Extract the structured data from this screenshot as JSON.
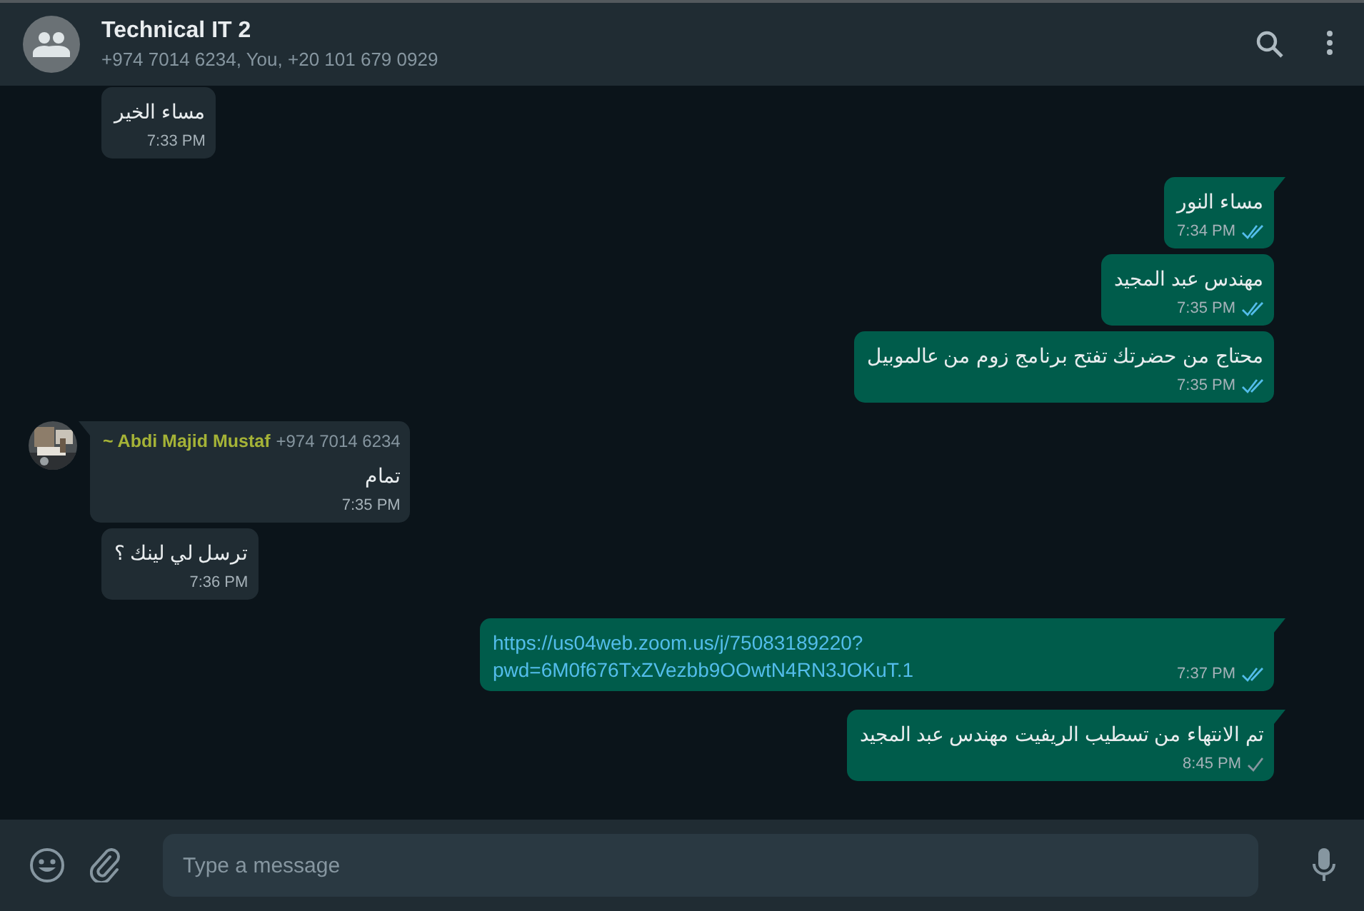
{
  "header": {
    "title": "Technical IT 2",
    "subtitle": "+974 7014 6234, You, +20 101 679 0929"
  },
  "messages": [
    {
      "kind": "incoming",
      "text": "مساء الخير",
      "time": "7:33 PM",
      "tail": false
    },
    {
      "kind": "outgoing",
      "text": "مساء النور",
      "time": "7:34 PM",
      "tail": true,
      "delivered": true,
      "read": true
    },
    {
      "kind": "outgoing",
      "text": "مهندس عبد المجيد",
      "time": "7:35 PM",
      "tail": false,
      "delivered": true,
      "read": true
    },
    {
      "kind": "outgoing",
      "text": "محتاج من حضرتك تفتح برنامج زوم من عالموبيل",
      "time": "7:35 PM",
      "tail": false,
      "delivered": true,
      "read": true
    },
    {
      "kind": "incoming",
      "text": "تمام",
      "time": "7:35 PM",
      "tail": true,
      "sender": {
        "name": "~ Abdi Majid Mustaf",
        "phone": "+974 7014 6234",
        "color": "#a5b337"
      }
    },
    {
      "kind": "incoming",
      "text": "ترسل لي لينك ؟",
      "time": "7:36 PM",
      "tail": false
    },
    {
      "kind": "outgoing",
      "text": "https://us04web.zoom.us/j/75083189220?pwd=6M0f676TxZVezbb9OOwtN4RN3JOKuT.1",
      "link": true,
      "time": "7:37 PM",
      "tail": true,
      "delivered": true,
      "read": true
    },
    {
      "kind": "outgoing",
      "text": "تم الانتهاء من تسطيب الريفيت مهندس عبد المجيد",
      "time": "8:45 PM",
      "tail": true,
      "delivered": false,
      "read": false
    }
  ],
  "composer": {
    "placeholder": "Type a message"
  }
}
